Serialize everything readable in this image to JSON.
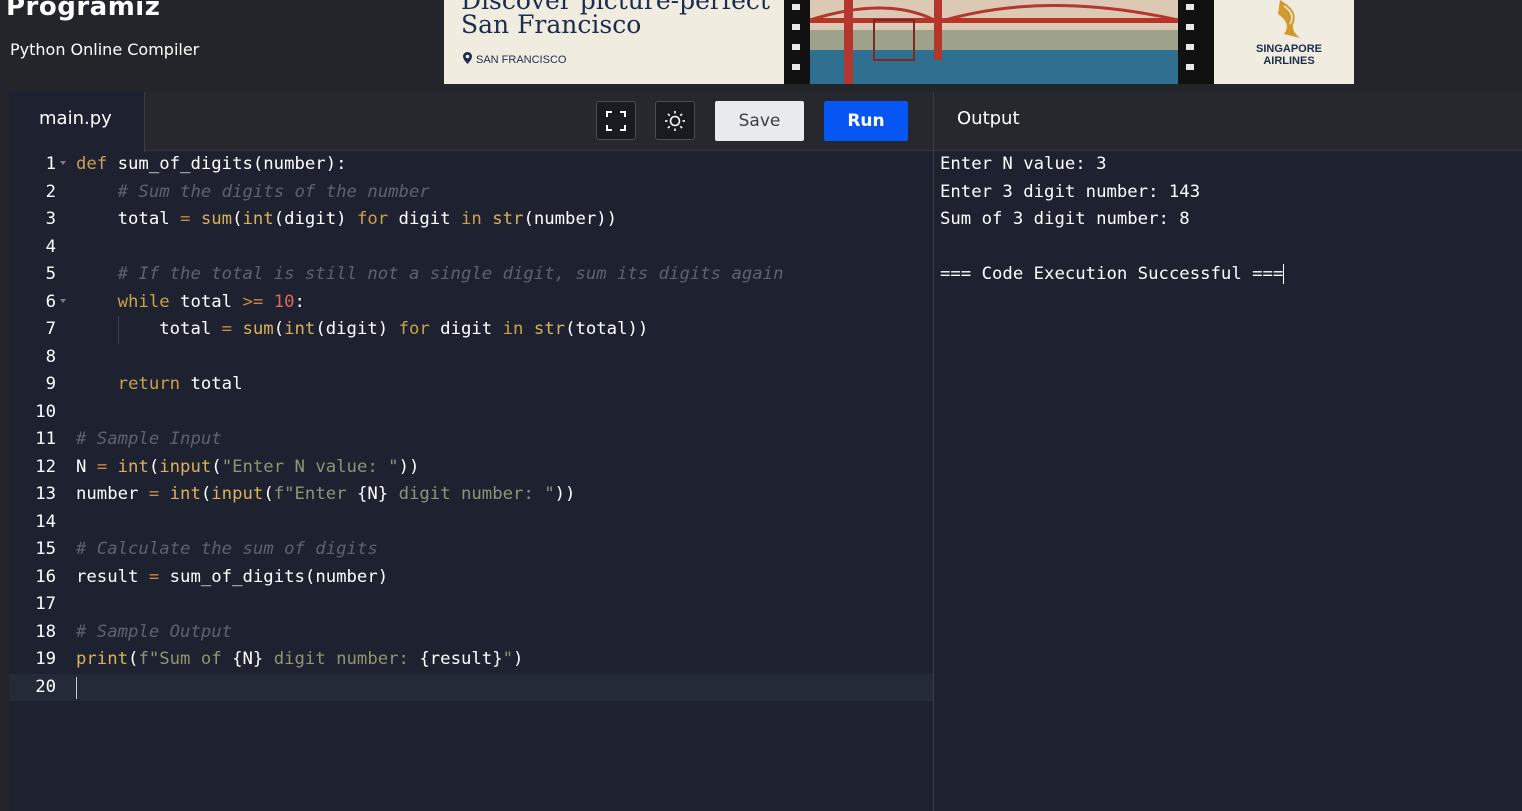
{
  "header": {
    "logo": "Programiz",
    "subtitle": "Python Online Compiler"
  },
  "ad": {
    "headline_line1": "Discover picture-perfect",
    "headline_line2": "San Francisco",
    "location": "SAN FRANCISCO",
    "airline_line1": "SINGAPORE",
    "airline_line2": "AIRLINES"
  },
  "editor": {
    "tab_label": "main.py",
    "save_label": "Save",
    "run_label": "Run",
    "icons": {
      "fullscreen": "fullscreen-icon",
      "theme": "sun-icon"
    }
  },
  "code": [
    "def sum_of_digits(number):",
    "    # Sum the digits of the number",
    "    total = sum(int(digit) for digit in str(number))",
    "",
    "    # If the total is still not a single digit, sum its digits again",
    "    while total >= 10:",
    "        total = sum(int(digit) for digit in str(total))",
    "",
    "    return total",
    "",
    "# Sample Input",
    "N = int(input(\"Enter N value: \"))",
    "number = int(input(f\"Enter {N} digit number: \"))",
    "",
    "# Calculate the sum of digits",
    "result = sum_of_digits(number)",
    "",
    "# Sample Output",
    "print(f\"Sum of {N} digit number: {result}\")",
    ""
  ],
  "line_numbers": [
    "1",
    "2",
    "3",
    "4",
    "5",
    "6",
    "7",
    "8",
    "9",
    "10",
    "11",
    "12",
    "13",
    "14",
    "15",
    "16",
    "17",
    "18",
    "19",
    "20"
  ],
  "output": {
    "title": "Output",
    "lines": [
      "Enter N value: 3",
      "Enter 3 digit number: 143",
      "Sum of 3 digit number: 8",
      "",
      "=== Code Execution Successful ==="
    ]
  }
}
